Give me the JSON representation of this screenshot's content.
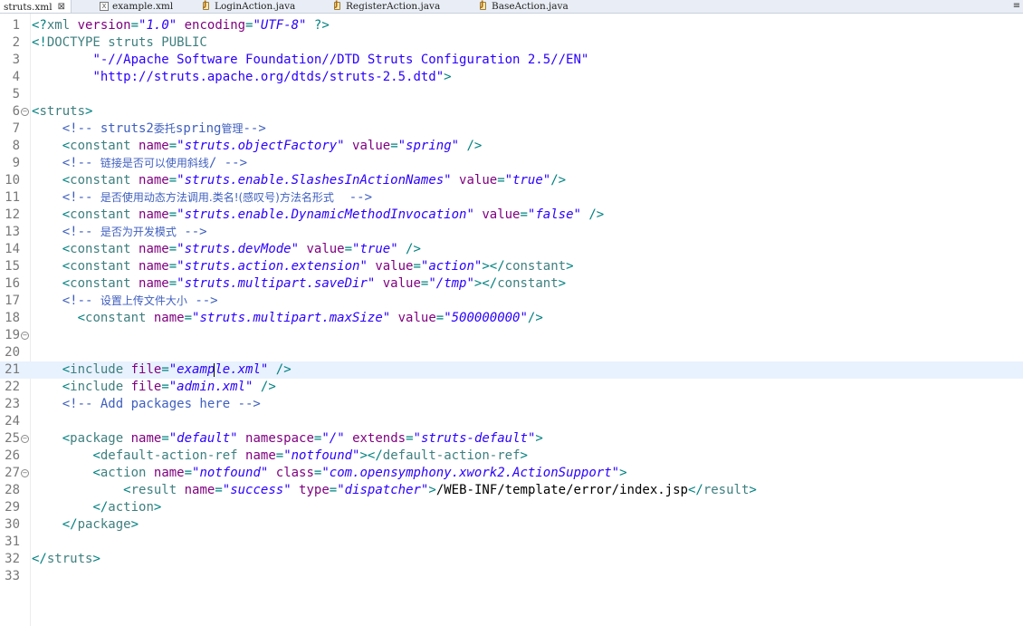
{
  "tabs": [
    {
      "label": "struts.xml",
      "icon": "xml-file-icon",
      "active": true,
      "closable": true
    },
    {
      "label": "example.xml",
      "icon": "xml-file-icon",
      "active": false
    },
    {
      "label": "LoginAction.java",
      "icon": "java-file-icon",
      "active": false
    },
    {
      "label": "RegisterAction.java",
      "icon": "java-file-icon",
      "active": false
    },
    {
      "label": "BaseAction.java",
      "icon": "java-file-icon",
      "active": false
    }
  ],
  "close_glyph": "⊠",
  "tab_menu_glyph": "≡",
  "current_line": 21,
  "lines": [
    {
      "n": "1",
      "fold": false,
      "tokens": [
        [
          "p",
          "<?"
        ],
        [
          "t",
          "xml "
        ],
        [
          "a",
          "version"
        ],
        [
          "p",
          "="
        ],
        [
          "v",
          "\"1.0\""
        ],
        [
          "a",
          " encoding"
        ],
        [
          "p",
          "="
        ],
        [
          "v",
          "\"UTF-8\""
        ],
        [
          "p",
          " ?>"
        ]
      ]
    },
    {
      "n": "2",
      "fold": false,
      "tokens": [
        [
          "p",
          "<!"
        ],
        [
          "dt",
          "DOCTYPE struts PUBLIC"
        ]
      ]
    },
    {
      "n": "3",
      "fold": false,
      "tokens": [
        [
          "tx",
          "        "
        ],
        [
          "dv",
          "\"-//Apache Software Foundation//DTD Struts Configuration 2.5//EN\""
        ]
      ]
    },
    {
      "n": "4",
      "fold": false,
      "tokens": [
        [
          "tx",
          "        "
        ],
        [
          "dv",
          "\"http://struts.apache.org/dtds/struts-2.5.dtd\""
        ],
        [
          "p",
          ">"
        ]
      ]
    },
    {
      "n": "5",
      "fold": false,
      "tokens": []
    },
    {
      "n": "6",
      "fold": true,
      "tokens": [
        [
          "p",
          "<"
        ],
        [
          "t",
          "struts"
        ],
        [
          "p",
          ">"
        ]
      ]
    },
    {
      "n": "7",
      "fold": false,
      "tokens": [
        [
          "tx",
          "    "
        ],
        [
          "c",
          "<!-- struts2"
        ],
        [
          "c cjk",
          "委托"
        ],
        [
          "c",
          "spring"
        ],
        [
          "c cjk",
          "管理"
        ],
        [
          "c",
          "-->"
        ]
      ]
    },
    {
      "n": "8",
      "fold": false,
      "tokens": [
        [
          "tx",
          "    "
        ],
        [
          "p",
          "<"
        ],
        [
          "t",
          "constant "
        ],
        [
          "a",
          "name"
        ],
        [
          "p",
          "="
        ],
        [
          "v",
          "\"struts.objectFactory\""
        ],
        [
          "a",
          " value"
        ],
        [
          "p",
          "="
        ],
        [
          "v",
          "\"spring\""
        ],
        [
          "p",
          " />"
        ]
      ]
    },
    {
      "n": "9",
      "fold": false,
      "tokens": [
        [
          "tx",
          "    "
        ],
        [
          "c",
          "<!-- "
        ],
        [
          "c cjk",
          "链接是否可以使用斜线"
        ],
        [
          "c",
          "/ -->"
        ]
      ]
    },
    {
      "n": "10",
      "fold": false,
      "tokens": [
        [
          "tx",
          "    "
        ],
        [
          "p",
          "<"
        ],
        [
          "t",
          "constant "
        ],
        [
          "a",
          "name"
        ],
        [
          "p",
          "="
        ],
        [
          "v",
          "\"struts.enable.SlashesInActionNames\""
        ],
        [
          "a",
          " value"
        ],
        [
          "p",
          "="
        ],
        [
          "v",
          "\"true\""
        ],
        [
          "p",
          "/>"
        ]
      ]
    },
    {
      "n": "11",
      "fold": false,
      "tokens": [
        [
          "tx",
          "    "
        ],
        [
          "c",
          "<!-- "
        ],
        [
          "c cjk",
          "是否使用动态方法调用.类名!(感叹号)方法名形式"
        ],
        [
          "c",
          "  -->"
        ]
      ]
    },
    {
      "n": "12",
      "fold": false,
      "tokens": [
        [
          "tx",
          "    "
        ],
        [
          "p",
          "<"
        ],
        [
          "t",
          "constant "
        ],
        [
          "a",
          "name"
        ],
        [
          "p",
          "="
        ],
        [
          "v",
          "\"struts.enable.DynamicMethodInvocation\""
        ],
        [
          "a",
          " value"
        ],
        [
          "p",
          "="
        ],
        [
          "v",
          "\"false\""
        ],
        [
          "p",
          " />"
        ]
      ]
    },
    {
      "n": "13",
      "fold": false,
      "tokens": [
        [
          "tx",
          "    "
        ],
        [
          "c",
          "<!-- "
        ],
        [
          "c cjk",
          "是否为开发模式"
        ],
        [
          "c",
          " -->"
        ]
      ]
    },
    {
      "n": "14",
      "fold": false,
      "tokens": [
        [
          "tx",
          "    "
        ],
        [
          "p",
          "<"
        ],
        [
          "t",
          "constant "
        ],
        [
          "a",
          "name"
        ],
        [
          "p",
          "="
        ],
        [
          "v",
          "\"struts.devMode\""
        ],
        [
          "a",
          " value"
        ],
        [
          "p",
          "="
        ],
        [
          "v",
          "\"true\""
        ],
        [
          "p",
          " />"
        ]
      ]
    },
    {
      "n": "15",
      "fold": false,
      "tokens": [
        [
          "tx",
          "    "
        ],
        [
          "p",
          "<"
        ],
        [
          "t",
          "constant "
        ],
        [
          "a",
          "name"
        ],
        [
          "p",
          "="
        ],
        [
          "v",
          "\"struts.action.extension\""
        ],
        [
          "a",
          " value"
        ],
        [
          "p",
          "="
        ],
        [
          "v",
          "\"action\""
        ],
        [
          "p",
          "></"
        ],
        [
          "t",
          "constant"
        ],
        [
          "p",
          ">"
        ]
      ]
    },
    {
      "n": "16",
      "fold": false,
      "tokens": [
        [
          "tx",
          "    "
        ],
        [
          "p",
          "<"
        ],
        [
          "t",
          "constant "
        ],
        [
          "a",
          "name"
        ],
        [
          "p",
          "="
        ],
        [
          "v",
          "\"struts.multipart.saveDir\""
        ],
        [
          "a",
          " value"
        ],
        [
          "p",
          "="
        ],
        [
          "v",
          "\"/tmp\""
        ],
        [
          "p",
          "></"
        ],
        [
          "t",
          "constant"
        ],
        [
          "p",
          ">"
        ]
      ]
    },
    {
      "n": "17",
      "fold": false,
      "tokens": [
        [
          "tx",
          "    "
        ],
        [
          "c",
          "<!-- "
        ],
        [
          "c cjk",
          "设置上传文件大小"
        ],
        [
          "c",
          " -->"
        ]
      ]
    },
    {
      "n": "18",
      "fold": false,
      "tokens": [
        [
          "tx",
          "      "
        ],
        [
          "p",
          "<"
        ],
        [
          "t",
          "constant "
        ],
        [
          "a",
          "name"
        ],
        [
          "p",
          "="
        ],
        [
          "v",
          "\"struts.multipart.maxSize\""
        ],
        [
          "a",
          " value"
        ],
        [
          "p",
          "="
        ],
        [
          "v",
          "\"500000000\""
        ],
        [
          "p",
          "/>"
        ]
      ]
    },
    {
      "n": "19",
      "fold": true,
      "tokens": []
    },
    {
      "n": "20",
      "fold": false,
      "tokens": []
    },
    {
      "n": "21",
      "fold": false,
      "tokens": [
        [
          "tx",
          "    "
        ],
        [
          "p",
          "<"
        ],
        [
          "t",
          "include "
        ],
        [
          "a",
          "file"
        ],
        [
          "p",
          "="
        ],
        [
          "v",
          "\"examp"
        ],
        [
          "caret",
          ""
        ],
        [
          "v",
          "le.xml\""
        ],
        [
          "p",
          " />"
        ]
      ]
    },
    {
      "n": "22",
      "fold": false,
      "tokens": [
        [
          "tx",
          "    "
        ],
        [
          "p",
          "<"
        ],
        [
          "t",
          "include "
        ],
        [
          "a",
          "file"
        ],
        [
          "p",
          "="
        ],
        [
          "v",
          "\"admin.xml\""
        ],
        [
          "p",
          " />"
        ]
      ]
    },
    {
      "n": "23",
      "fold": false,
      "tokens": [
        [
          "tx",
          "    "
        ],
        [
          "c",
          "<!-- Add packages here -->"
        ]
      ]
    },
    {
      "n": "24",
      "fold": false,
      "tokens": []
    },
    {
      "n": "25",
      "fold": true,
      "tokens": [
        [
          "tx",
          "    "
        ],
        [
          "p",
          "<"
        ],
        [
          "t",
          "package "
        ],
        [
          "a",
          "name"
        ],
        [
          "p",
          "="
        ],
        [
          "v",
          "\"default\""
        ],
        [
          "a",
          " namespace"
        ],
        [
          "p",
          "="
        ],
        [
          "v",
          "\"/\""
        ],
        [
          "a",
          " extends"
        ],
        [
          "p",
          "="
        ],
        [
          "v",
          "\"struts-default\""
        ],
        [
          "p",
          ">"
        ]
      ]
    },
    {
      "n": "26",
      "fold": false,
      "tokens": [
        [
          "tx",
          "        "
        ],
        [
          "p",
          "<"
        ],
        [
          "t",
          "default-action-ref "
        ],
        [
          "a",
          "name"
        ],
        [
          "p",
          "="
        ],
        [
          "v",
          "\"notfound\""
        ],
        [
          "p",
          "></"
        ],
        [
          "t",
          "default-action-ref"
        ],
        [
          "p",
          ">"
        ]
      ]
    },
    {
      "n": "27",
      "fold": true,
      "tokens": [
        [
          "tx",
          "        "
        ],
        [
          "p",
          "<"
        ],
        [
          "t",
          "action "
        ],
        [
          "a",
          "name"
        ],
        [
          "p",
          "="
        ],
        [
          "v",
          "\"notfound\""
        ],
        [
          "a",
          " class"
        ],
        [
          "p",
          "="
        ],
        [
          "v",
          "\"com.opensymphony.xwork2.ActionSupport\""
        ],
        [
          "p",
          ">"
        ]
      ]
    },
    {
      "n": "28",
      "fold": false,
      "tokens": [
        [
          "tx",
          "            "
        ],
        [
          "p",
          "<"
        ],
        [
          "t",
          "result "
        ],
        [
          "a",
          "name"
        ],
        [
          "p",
          "="
        ],
        [
          "v",
          "\"success\""
        ],
        [
          "a",
          " type"
        ],
        [
          "p",
          "="
        ],
        [
          "v",
          "\"dispatcher\""
        ],
        [
          "p",
          ">"
        ],
        [
          "tx",
          "/WEB-INF/template/error/index.jsp"
        ],
        [
          "p",
          "</"
        ],
        [
          "t",
          "result"
        ],
        [
          "p",
          ">"
        ]
      ]
    },
    {
      "n": "29",
      "fold": false,
      "tokens": [
        [
          "tx",
          "        "
        ],
        [
          "p",
          "</"
        ],
        [
          "t",
          "action"
        ],
        [
          "p",
          ">"
        ]
      ]
    },
    {
      "n": "30",
      "fold": false,
      "tokens": [
        [
          "tx",
          "    "
        ],
        [
          "p",
          "</"
        ],
        [
          "t",
          "package"
        ],
        [
          "p",
          ">"
        ]
      ]
    },
    {
      "n": "31",
      "fold": false,
      "tokens": []
    },
    {
      "n": "32",
      "fold": false,
      "tokens": [
        [
          "p",
          "</"
        ],
        [
          "t",
          "struts"
        ],
        [
          "p",
          ">"
        ]
      ]
    },
    {
      "n": "33",
      "fold": false,
      "tokens": []
    }
  ],
  "fold_glyph": "⊖"
}
